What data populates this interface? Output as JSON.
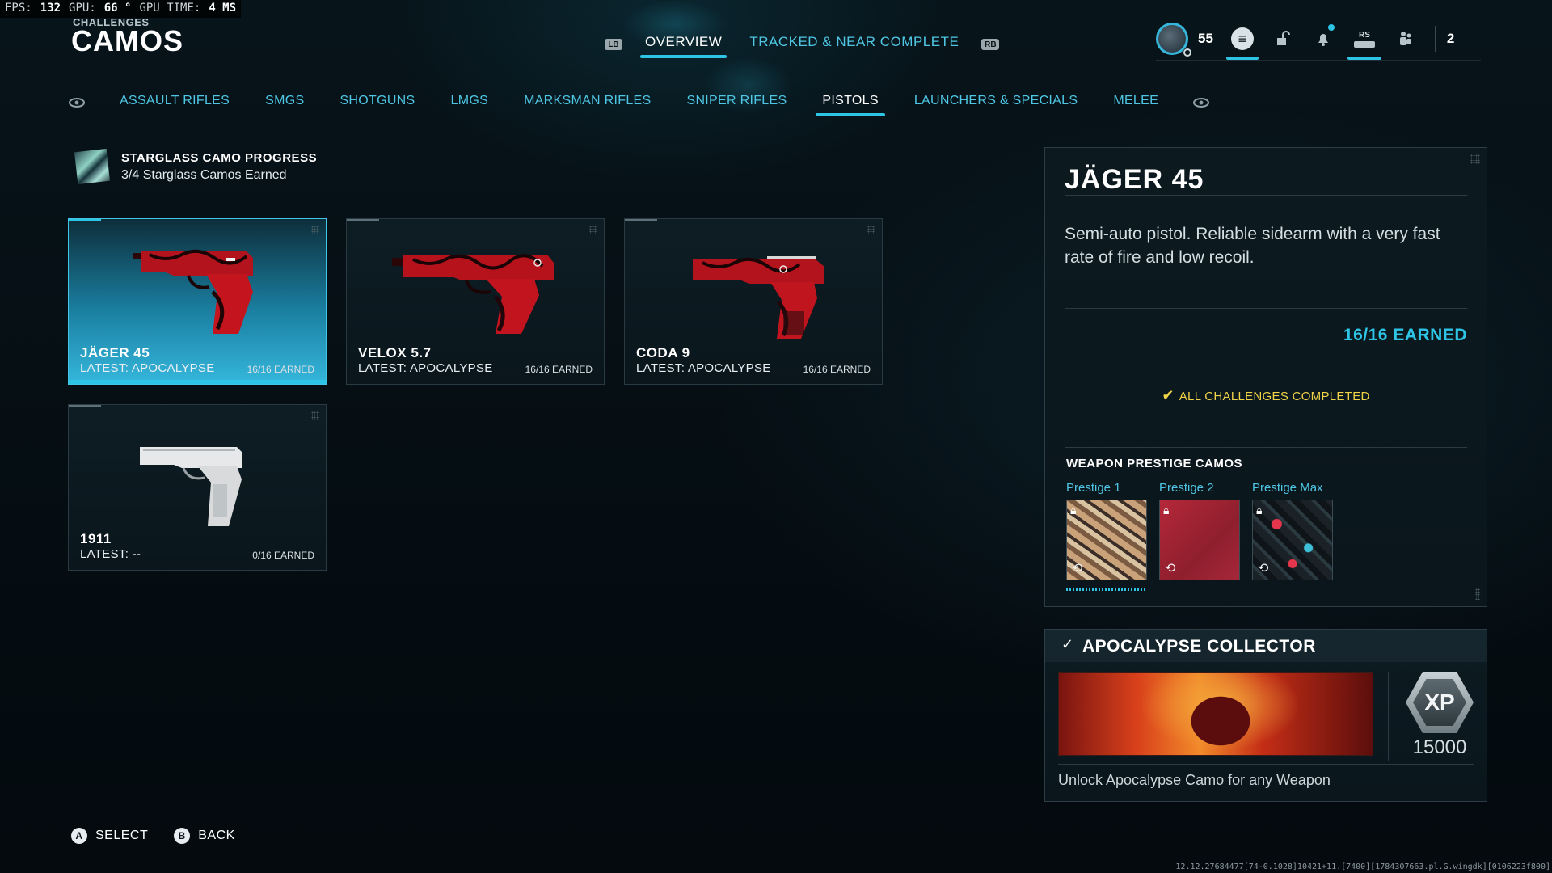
{
  "perf": {
    "fps_label": "FPS:",
    "fps": "132",
    "gpu_label": "GPU:",
    "gpu": "66 °",
    "gpu_time_label": "GPU TIME:",
    "gpu_time": "4 MS"
  },
  "header": {
    "kicker": "CHALLENGES",
    "title": "CAMOS",
    "left_bumper": "LB",
    "right_bumper": "RB",
    "tabs": [
      {
        "label": "OVERVIEW",
        "active": true
      },
      {
        "label": "TRACKED & NEAR COMPLETE",
        "active": false
      }
    ]
  },
  "hud": {
    "level": "55",
    "rs_label": "RS",
    "party_count": "2",
    "icons": [
      "avatar-icon",
      "menu-icon",
      "unlock-icon",
      "bell-icon",
      "rs-icon",
      "party-icon"
    ],
    "accent": "#2ec4e6"
  },
  "categories": [
    {
      "label": "ASSAULT RIFLES",
      "active": false
    },
    {
      "label": "SMGS",
      "active": false
    },
    {
      "label": "SHOTGUNS",
      "active": false
    },
    {
      "label": "LMGS",
      "active": false
    },
    {
      "label": "MARKSMAN RIFLES",
      "active": false
    },
    {
      "label": "SNIPER RIFLES",
      "active": false
    },
    {
      "label": "PISTOLS",
      "active": true
    },
    {
      "label": "LAUNCHERS & SPECIALS",
      "active": false
    },
    {
      "label": "MELEE",
      "active": false
    }
  ],
  "starglass": {
    "title": "STARGLASS CAMO PROGRESS",
    "subtitle": "3/4 Starglass Camos Earned"
  },
  "weapons": [
    {
      "name": "JÄGER 45",
      "latest": "LATEST: APOCALYPSE",
      "earned": "16/16 EARNED",
      "selected": true,
      "camo": "red"
    },
    {
      "name": "VELOX 5.7",
      "latest": "LATEST: APOCALYPSE",
      "earned": "16/16 EARNED",
      "selected": false,
      "camo": "red"
    },
    {
      "name": "CODA 9",
      "latest": "LATEST: APOCALYPSE",
      "earned": "16/16 EARNED",
      "selected": false,
      "camo": "red"
    },
    {
      "name": "1911",
      "latest": "LATEST: --",
      "earned": "0/16 EARNED",
      "selected": false,
      "camo": "white"
    }
  ],
  "detail": {
    "title": "JÄGER 45",
    "description": "Semi-auto pistol. Reliable sidearm with a very fast rate of fire and low recoil.",
    "earned": "16/16 EARNED",
    "completed": "ALL CHALLENGES COMPLETED",
    "prestige_heading": "WEAPON PRESTIGE CAMOS",
    "prestige": [
      {
        "label": "Prestige 1",
        "locked": true
      },
      {
        "label": "Prestige 2",
        "locked": true
      },
      {
        "label": "Prestige Max",
        "locked": true
      }
    ]
  },
  "reward": {
    "title": "APOCALYPSE COLLECTOR",
    "xp_label": "XP",
    "xp_amount": "15000",
    "description": "Unlock Apocalypse Camo for any Weapon"
  },
  "footer": {
    "select_glyph": "A",
    "select_label": "SELECT",
    "back_glyph": "B",
    "back_label": "BACK"
  },
  "build": "12.12.27684477[74-0.1028]10421+11.[7400][1784307663.pl.G.wingdk][0106223f800]"
}
